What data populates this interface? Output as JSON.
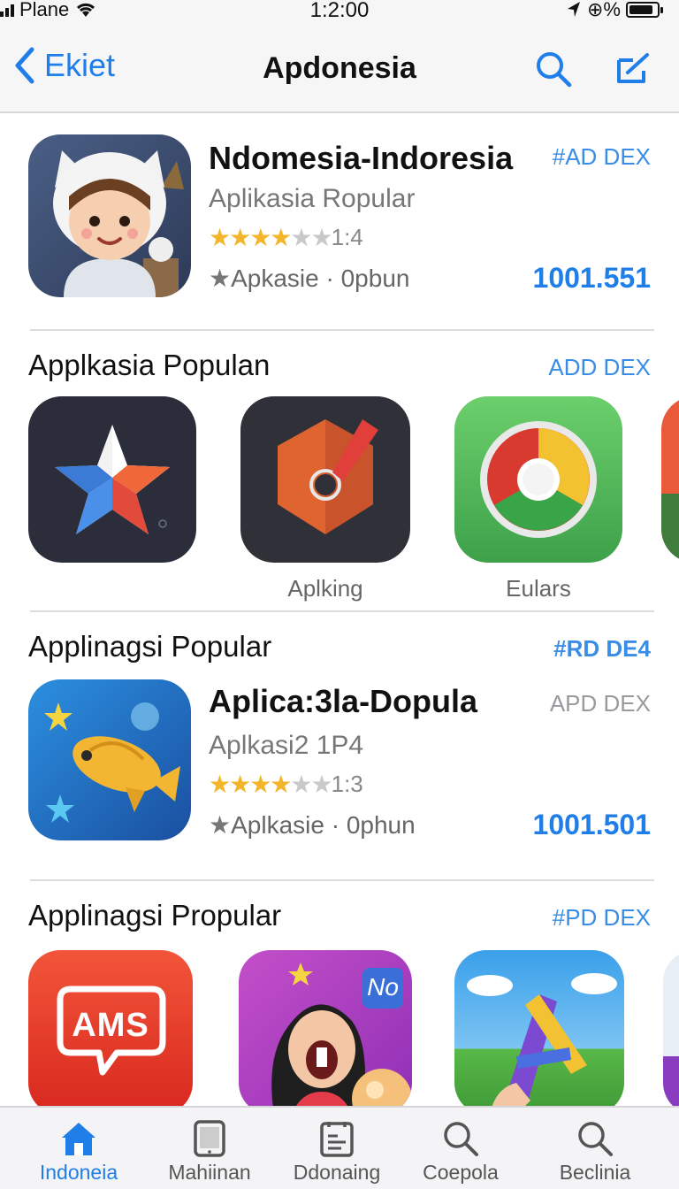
{
  "status_bar": {
    "carrier": "Plane",
    "time": "1:2:00",
    "battery_text": "⊕%"
  },
  "nav": {
    "back_label": "Ekiet",
    "title": "Apdonesia"
  },
  "featured_1": {
    "name": "Ndomesia-Indoresia",
    "subtitle": "Aplikasia Ropular",
    "rating_text": "1:4",
    "stars_filled": 4,
    "meta": "Apkasie · 0pbun",
    "tag": "#AD DEX",
    "price": "1001.551"
  },
  "section_1": {
    "title": "Applkasia Populan",
    "tag": "ADD DEX",
    "tiles": [
      {
        "label": "",
        "icon": "star-app-icon"
      },
      {
        "label": "Aplking",
        "icon": "tag-app-icon"
      },
      {
        "label": "Eulars",
        "icon": "chrome-app-icon"
      }
    ]
  },
  "section_2": {
    "title": "Applinagsi Popular",
    "tag": "#RD DE4",
    "app": {
      "name": "Aplica:3la-Dopula",
      "subtitle": "Aplkasi2 1P4",
      "rating_text": "1:3",
      "stars_filled": 4,
      "meta": "Aplkasie · 0phun",
      "tag": "APD DEX",
      "price": "1001.501"
    }
  },
  "section_3": {
    "title": "Applinagsi Propular",
    "tag": "#PD DEX",
    "tiles": [
      {
        "label": "",
        "icon": "ams-app-icon",
        "text": "AMS"
      },
      {
        "label": "",
        "icon": "girl-app-icon",
        "badge": "No"
      },
      {
        "label": "",
        "icon": "blocks-app-icon"
      }
    ]
  },
  "tabs": [
    {
      "label": "Indoneia",
      "icon": "home-icon",
      "active": true
    },
    {
      "label": "Mahiinan",
      "icon": "tablet-icon",
      "active": false
    },
    {
      "label": "Ddonaing",
      "icon": "document-icon",
      "active": false
    },
    {
      "label": "Coepola",
      "icon": "search-icon",
      "active": false
    },
    {
      "label": "Beclinia",
      "icon": "search-icon",
      "active": false
    }
  ],
  "colors": {
    "accent": "#1f7ee8",
    "star": "#f3b52a",
    "tag_blue": "#3a8de6"
  }
}
